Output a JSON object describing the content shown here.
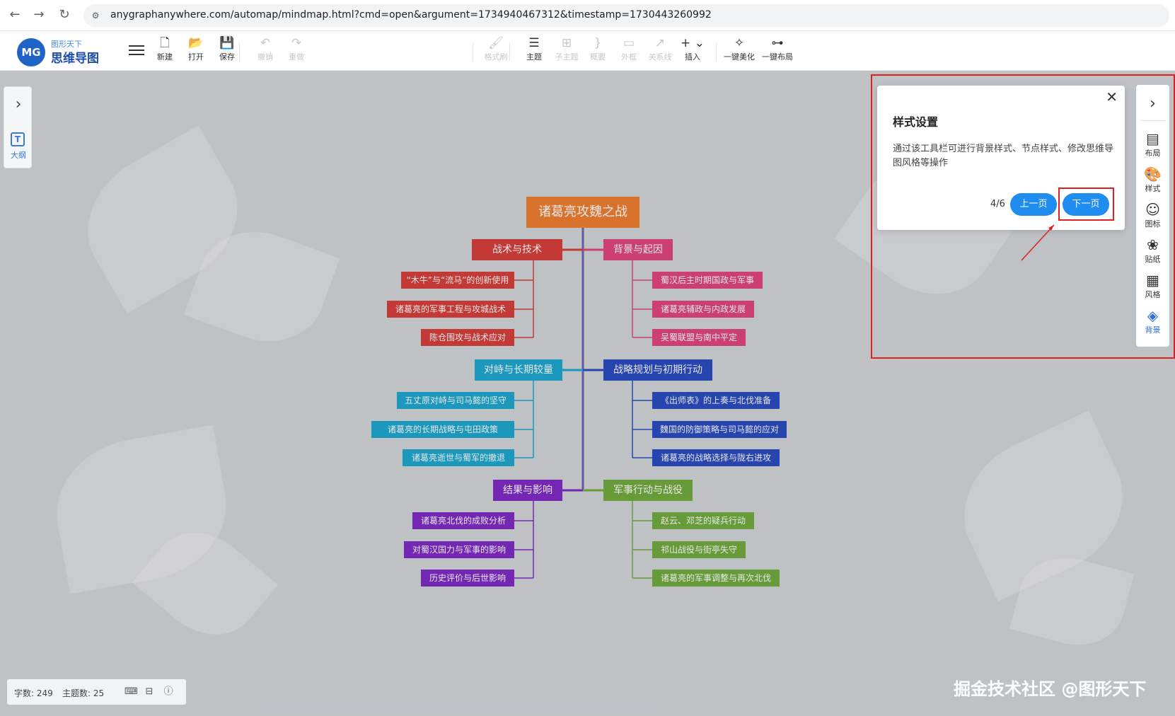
{
  "browser": {
    "back": "←",
    "forward": "→",
    "reload": "↻",
    "site_icon": "⚙",
    "url": "anygraphanywhere.com/automap/mindmap.html?cmd=open&argument=1734940467312&timestamp=1730443260992"
  },
  "app": {
    "logo_mark": "MG",
    "logo_small": "图形天下",
    "logo_big": "思维导图"
  },
  "toolbar": [
    {
      "name": "new-button",
      "glyph": "🗋",
      "label": "新建",
      "enabled": true
    },
    {
      "name": "open-button",
      "glyph": "📂",
      "label": "打开",
      "enabled": true
    },
    {
      "name": "save-button",
      "glyph": "💾",
      "label": "保存",
      "enabled": true
    },
    {
      "name": "undo-button",
      "glyph": "↶",
      "label": "撤销",
      "enabled": false
    },
    {
      "name": "redo-button",
      "glyph": "↷",
      "label": "重做",
      "enabled": false
    },
    {
      "name": "format-painter-button",
      "glyph": "🖌",
      "label": "格式刷",
      "enabled": false
    },
    {
      "name": "topic-button",
      "glyph": "☰",
      "label": "主题",
      "enabled": true
    },
    {
      "name": "subtopic-button",
      "glyph": "⊞",
      "label": "子主题",
      "enabled": false
    },
    {
      "name": "summary-button",
      "glyph": "}",
      "label": "概要",
      "enabled": false
    },
    {
      "name": "boundary-button",
      "glyph": "▭",
      "label": "外框",
      "enabled": false
    },
    {
      "name": "relation-line-button",
      "glyph": "↗",
      "label": "关系线",
      "enabled": false
    },
    {
      "name": "insert-button",
      "glyph": "+ ⌄",
      "label": "插入",
      "enabled": true
    },
    {
      "name": "auto-beautify-button",
      "glyph": "✧",
      "label": "一键美化",
      "enabled": true
    },
    {
      "name": "auto-layout-button",
      "glyph": "⊶",
      "label": "一键布局",
      "enabled": true
    }
  ],
  "left_panel": {
    "chevron": "›",
    "icon": "T",
    "label": "大纲"
  },
  "mindmap": {
    "root": "诸葛亮攻魏之战",
    "branches": [
      {
        "title": "战术与技术",
        "color": "#d63a35",
        "children": [
          "“木牛”与“流马”的创新使用",
          "诸葛亮的军事工程与攻城战术",
          "陈仓围攻与战术应对"
        ]
      },
      {
        "title": "背景与起因",
        "color": "#e0407c",
        "children": [
          "蜀汉后主时期国政与军事",
          "诸葛亮辅政与内政发展",
          "吴蜀联盟与南中平定"
        ]
      },
      {
        "title": "对峙与长期较量",
        "color": "#17a5cf",
        "children": [
          "五丈原对峙与司马懿的坚守",
          "诸葛亮的长期战略与屯田政策",
          "诸葛亮逝世与蜀军的撤退"
        ]
      },
      {
        "title": "战略规划与初期行动",
        "color": "#2447c0",
        "children": [
          "《出师表》的上奏与北伐准备",
          "魏国的防御策略与司马懿的应对",
          "诸葛亮的战略选择与陇右进攻"
        ]
      },
      {
        "title": "结果与影响",
        "color": "#7b25c4",
        "children": [
          "诸葛亮北伐的成败分析",
          "对蜀汉国力与军事的影响",
          "历史评价与后世影响"
        ]
      },
      {
        "title": "军事行动与战役",
        "color": "#6ea93a",
        "children": [
          "赵云、邓芝的疑兵行动",
          "祁山战役与街亭失守",
          "诸葛亮的军事调整与再次北伐"
        ]
      }
    ]
  },
  "right_sidebar": {
    "chevron": "›",
    "items": [
      {
        "name": "layout",
        "glyph": "▤",
        "label": "布局",
        "active": false
      },
      {
        "name": "style",
        "glyph": "🎨",
        "label": "样式",
        "active": false
      },
      {
        "name": "icon",
        "glyph": "☺",
        "label": "图标",
        "active": false
      },
      {
        "name": "sticker",
        "glyph": "❀",
        "label": "贴纸",
        "active": false
      },
      {
        "name": "theme-style",
        "glyph": "▦",
        "label": "风格",
        "active": false
      },
      {
        "name": "background",
        "glyph": "◈",
        "label": "背景",
        "active": true
      }
    ]
  },
  "tour_popup": {
    "close": "✕",
    "title": "样式设置",
    "description": "通过该工具栏可进行背景样式、节点样式、修改思维导图风格等操作",
    "step": "4/6",
    "prev_label": "上一页",
    "next_label": "下一页"
  },
  "status": {
    "word_count": "字数: 249",
    "topic_count": "主题数: 25"
  },
  "watermark": "掘金技术社区 @图形天下",
  "colors": {
    "root": "#f07a2c",
    "accent_blue": "#1f8cf0",
    "highlight_red": "#e02020"
  }
}
